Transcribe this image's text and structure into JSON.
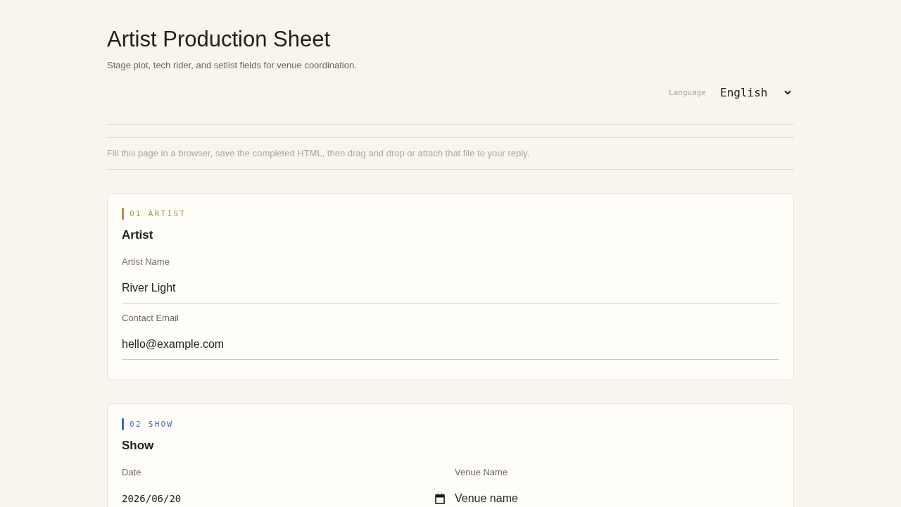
{
  "header": {
    "title": "Artist Production Sheet",
    "subtitle": "Stage plot, tech rider, and setlist fields for venue coordination."
  },
  "language": {
    "label": "Language",
    "value": "English"
  },
  "notice": "Fill this page in a browser, save the completed HTML, then drag and drop or attach that file to your reply.",
  "sections": [
    {
      "tag": "01 ARTIST",
      "color": "#b8913a",
      "title": "Artist",
      "rows": [
        [
          {
            "kind": "text",
            "label": "Artist Name",
            "value": "River Light"
          }
        ],
        [
          {
            "kind": "text",
            "label": "Contact Email",
            "value": "hello@example.com"
          }
        ]
      ]
    },
    {
      "tag": "02 SHOW",
      "color": "#3a6db8",
      "title": "Show",
      "rows": [
        [
          {
            "kind": "date",
            "label": "Date",
            "value": "2026/06/20"
          },
          {
            "kind": "text",
            "label": "Venue Name",
            "placeholder": "Venue name"
          }
        ]
      ]
    }
  ]
}
